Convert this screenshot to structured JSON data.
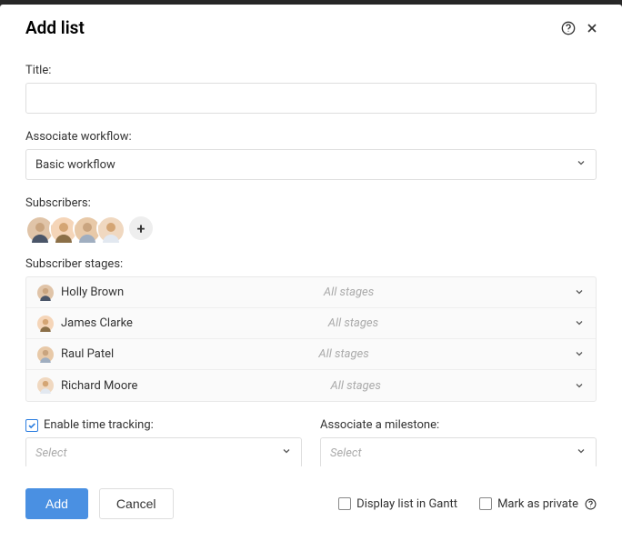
{
  "modal": {
    "title": "Add list"
  },
  "fields": {
    "title_label": "Title:",
    "title_value": "",
    "workflow_label": "Associate workflow:",
    "workflow_value": "Basic workflow",
    "subscribers_label": "Subscribers:",
    "stages_label": "Subscriber stages:",
    "time_tracking_label": "Enable time tracking:",
    "time_tracking_checked": true,
    "time_tracking_placeholder": "Select",
    "milestone_label": "Associate a milestone:",
    "milestone_placeholder": "Select"
  },
  "subscriber_stages": [
    {
      "name": "Holly Brown",
      "stage": "All stages"
    },
    {
      "name": "James Clarke",
      "stage": "All stages"
    },
    {
      "name": "Raul Patel",
      "stage": "All stages"
    },
    {
      "name": "Richard Moore",
      "stage": "All stages"
    }
  ],
  "footer": {
    "add": "Add",
    "cancel": "Cancel",
    "display_gantt": "Display list in Gantt",
    "mark_private": "Mark as private"
  },
  "avatar_colors": [
    {
      "bg": "#e0c4a8",
      "shirt": "#4a5568"
    },
    {
      "bg": "#f5d5b8",
      "shirt": "#8b6f47"
    },
    {
      "bg": "#e8c9a8",
      "shirt": "#a0aec0"
    },
    {
      "bg": "#f0d8c0",
      "shirt": "#e2e8f0"
    }
  ]
}
